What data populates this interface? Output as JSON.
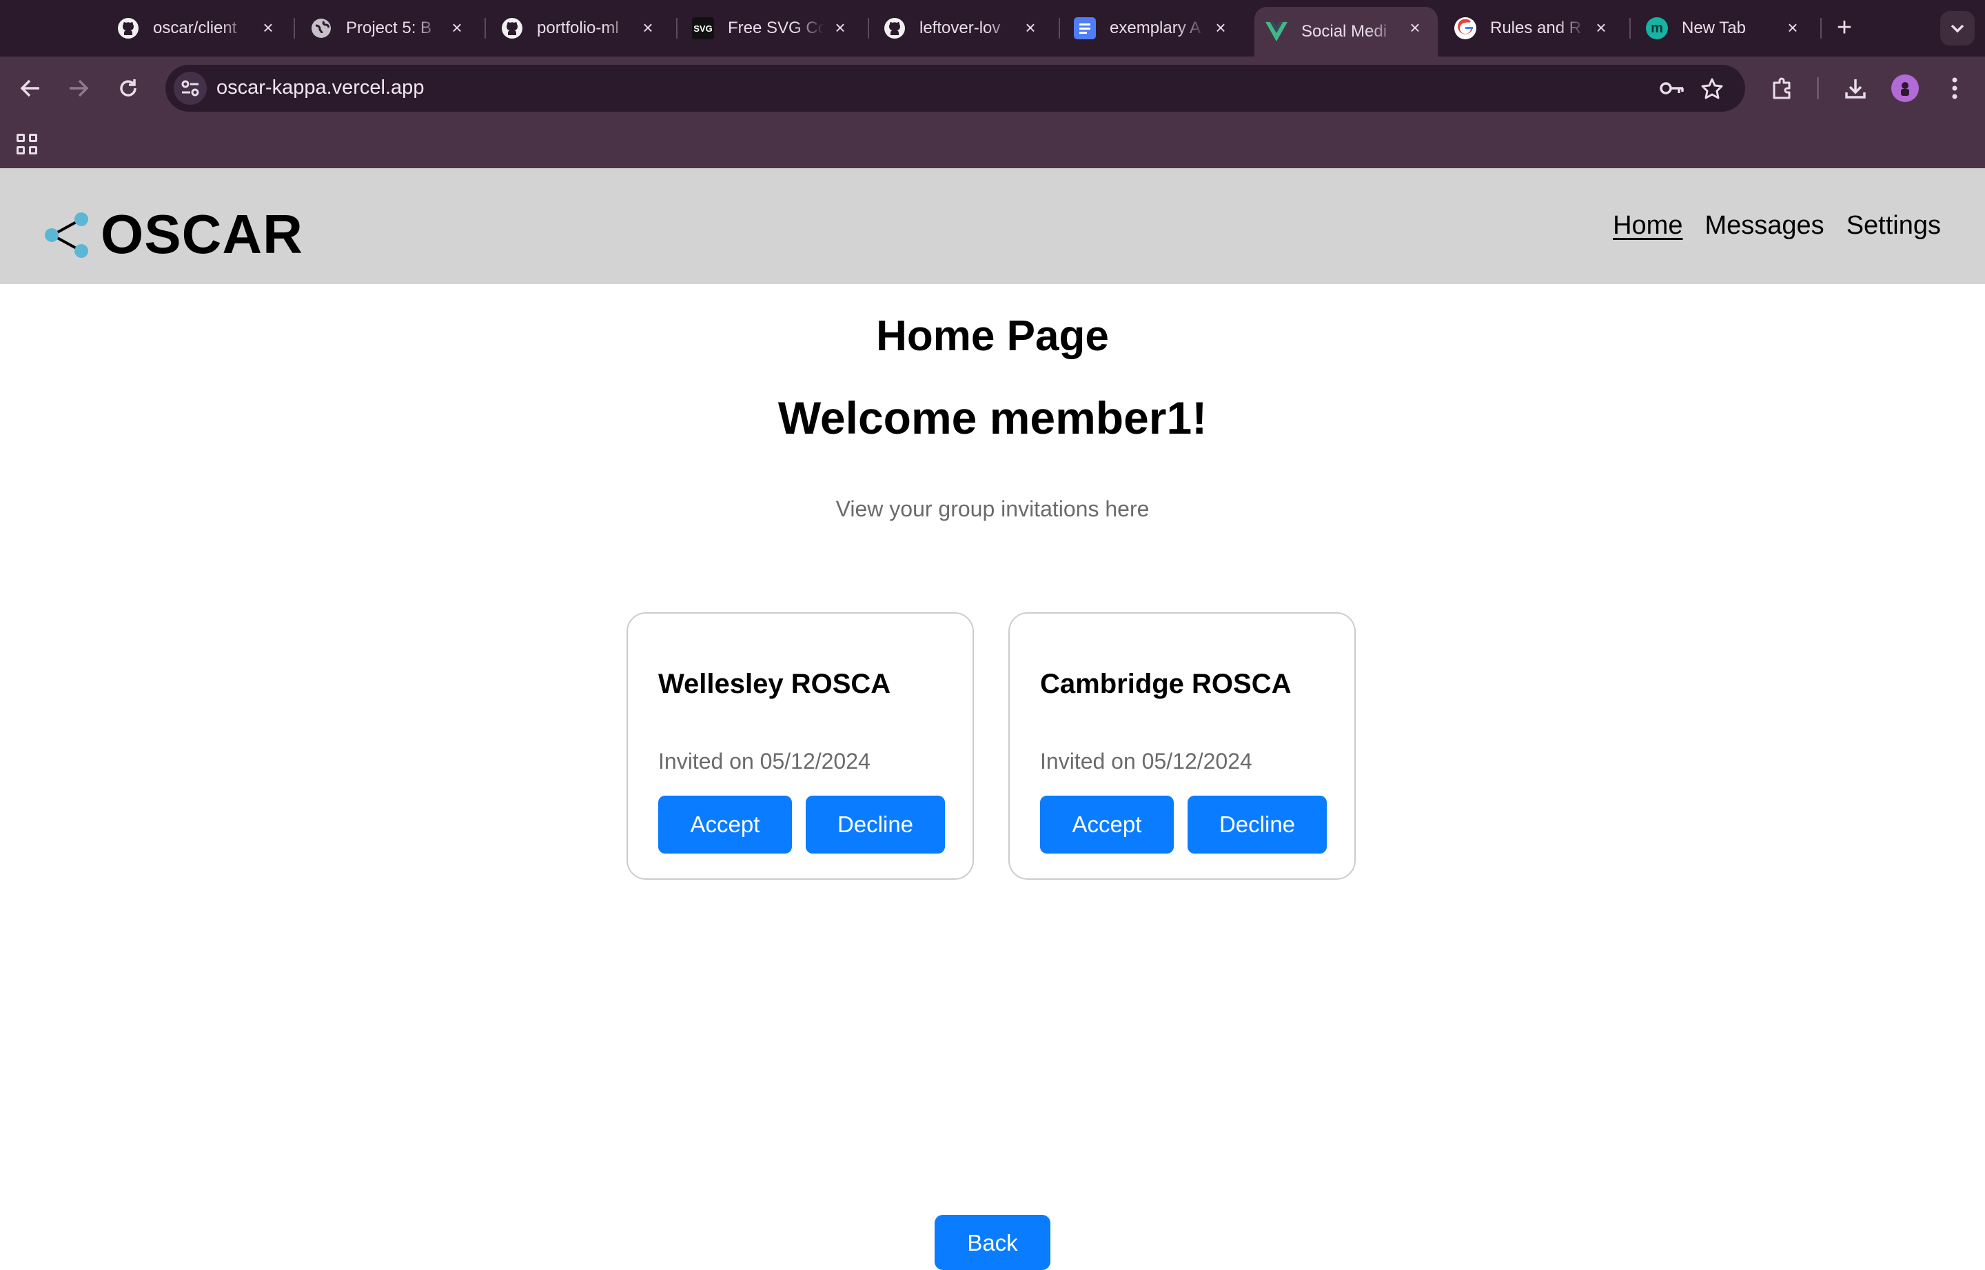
{
  "browser": {
    "tabs": [
      {
        "title": "oscar/client",
        "favicon": "github-icon"
      },
      {
        "title": "Project 5: B",
        "favicon": "globe-icon"
      },
      {
        "title": "portfolio-ml",
        "favicon": "github-icon"
      },
      {
        "title": "Free SVG Co",
        "favicon": "svg-icon"
      },
      {
        "title": "leftover-lov",
        "favicon": "github-icon"
      },
      {
        "title": "exemplary A",
        "favicon": "docs-icon"
      },
      {
        "title": "Social Medi",
        "favicon": "vue-icon",
        "active": true
      },
      {
        "title": "Rules and R",
        "favicon": "google-icon"
      },
      {
        "title": "New Tab",
        "favicon": "m-icon"
      }
    ],
    "url": "oscar-kappa.vercel.app",
    "svg_favicon_text": "SVG",
    "m_favicon_text": "m"
  },
  "header": {
    "logo_text": "OSCAR",
    "nav": {
      "home": "Home",
      "messages": "Messages",
      "settings": "Settings"
    },
    "accent_color": "#5bb8d4"
  },
  "main": {
    "title": "Home Page",
    "welcome": "Welcome member1!",
    "subtitle": "View your group invitations here",
    "invitations": [
      {
        "group": "Wellesley ROSCA",
        "invited": "Invited on 05/12/2024",
        "accept": "Accept",
        "decline": "Decline"
      },
      {
        "group": "Cambridge ROSCA",
        "invited": "Invited on 05/12/2024",
        "accept": "Accept",
        "decline": "Decline"
      }
    ],
    "back_label": "Back",
    "button_color": "#0a7cff"
  }
}
